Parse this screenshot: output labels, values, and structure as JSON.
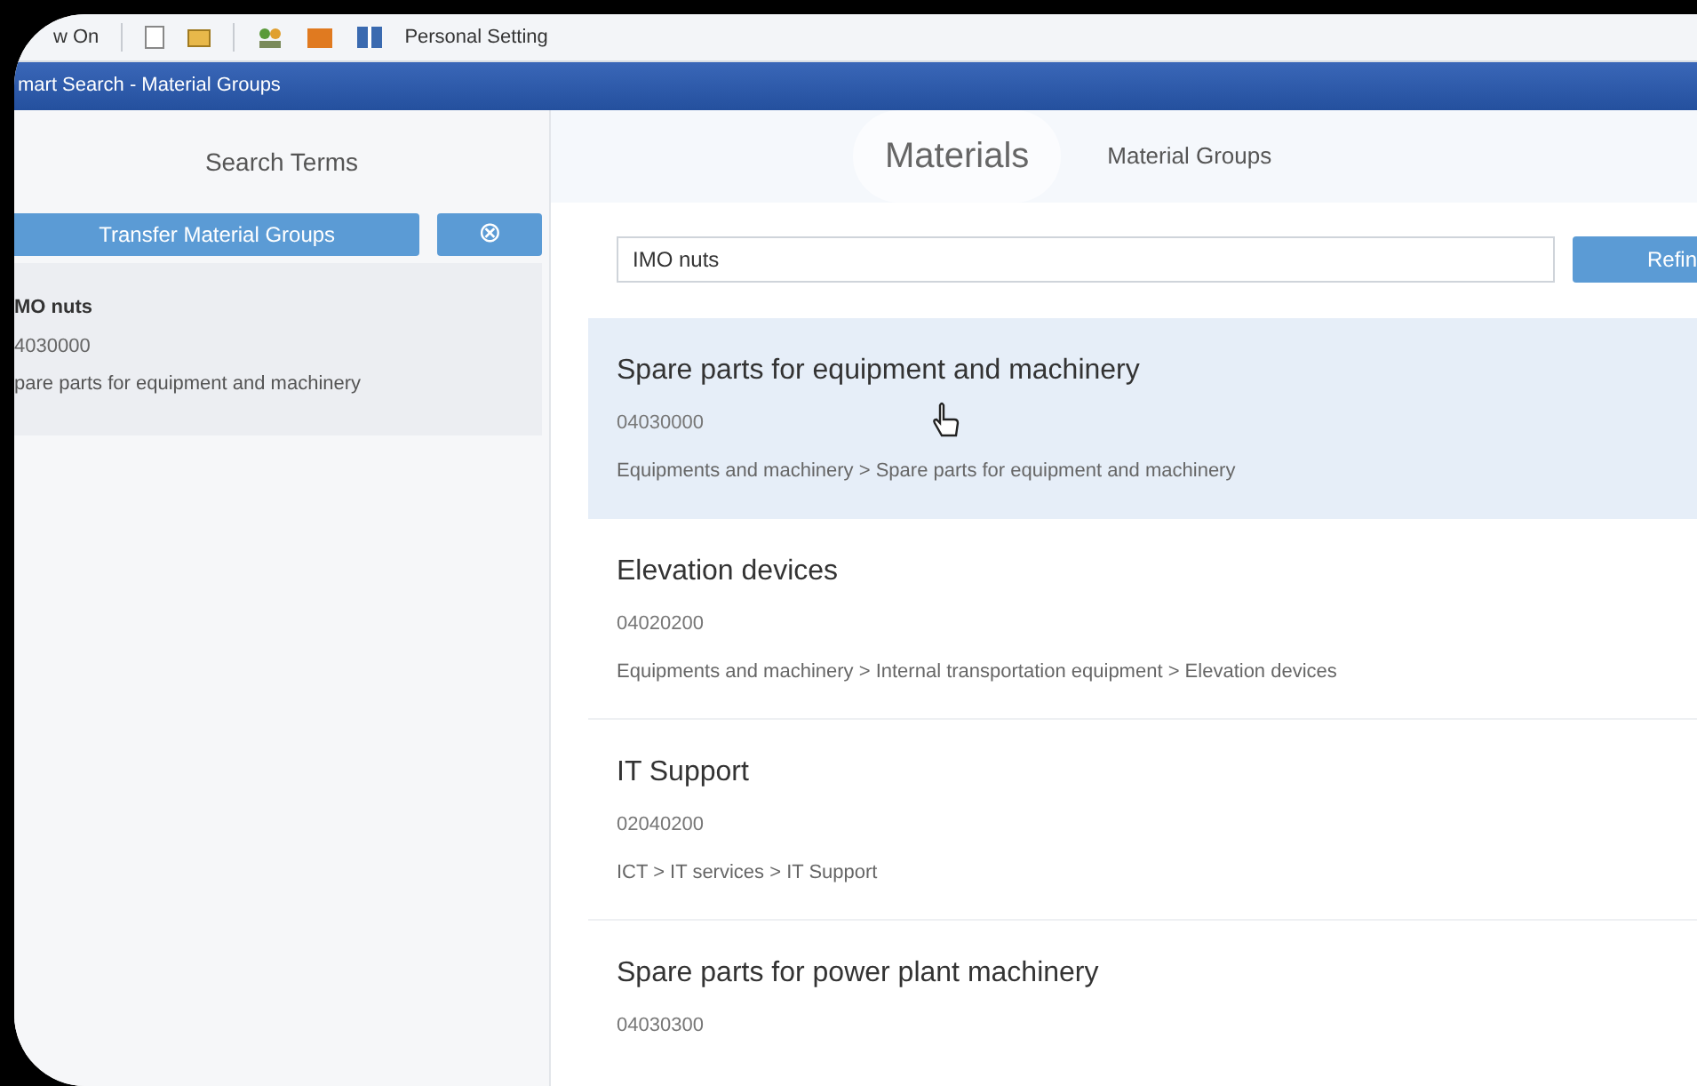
{
  "toolbar": {
    "label": "w On",
    "items": [
      {
        "label": "Personal Setting"
      }
    ]
  },
  "window": {
    "title": "mart Search - Material Groups"
  },
  "search_terms": {
    "title": "Search Terms",
    "transfer_button": "Transfer Material Groups",
    "close_button": "⊗",
    "items": [
      {
        "name": "MO nuts",
        "code": "4030000",
        "description": "pare parts for equipment and machinery"
      }
    ]
  },
  "tabs": [
    {
      "label": "Materials",
      "selected": true
    },
    {
      "label": "Material Groups",
      "selected": false
    }
  ],
  "search": {
    "value": "IMO nuts",
    "button": "Refin"
  },
  "results": [
    {
      "title": "Spare parts for equipment and machinery",
      "code": "04030000",
      "path": "Equipments and machinery > Spare parts for equipment and machinery",
      "selected": true
    },
    {
      "title": "Elevation devices",
      "code": "04020200",
      "path": "Equipments and machinery > Internal transportation equipment > Elevation devices",
      "selected": false
    },
    {
      "title": "IT Support",
      "code": "02040200",
      "path": "ICT > IT services > IT Support",
      "selected": false
    },
    {
      "title": "Spare parts for power plant machinery",
      "code": "04030300",
      "selected": false
    }
  ]
}
